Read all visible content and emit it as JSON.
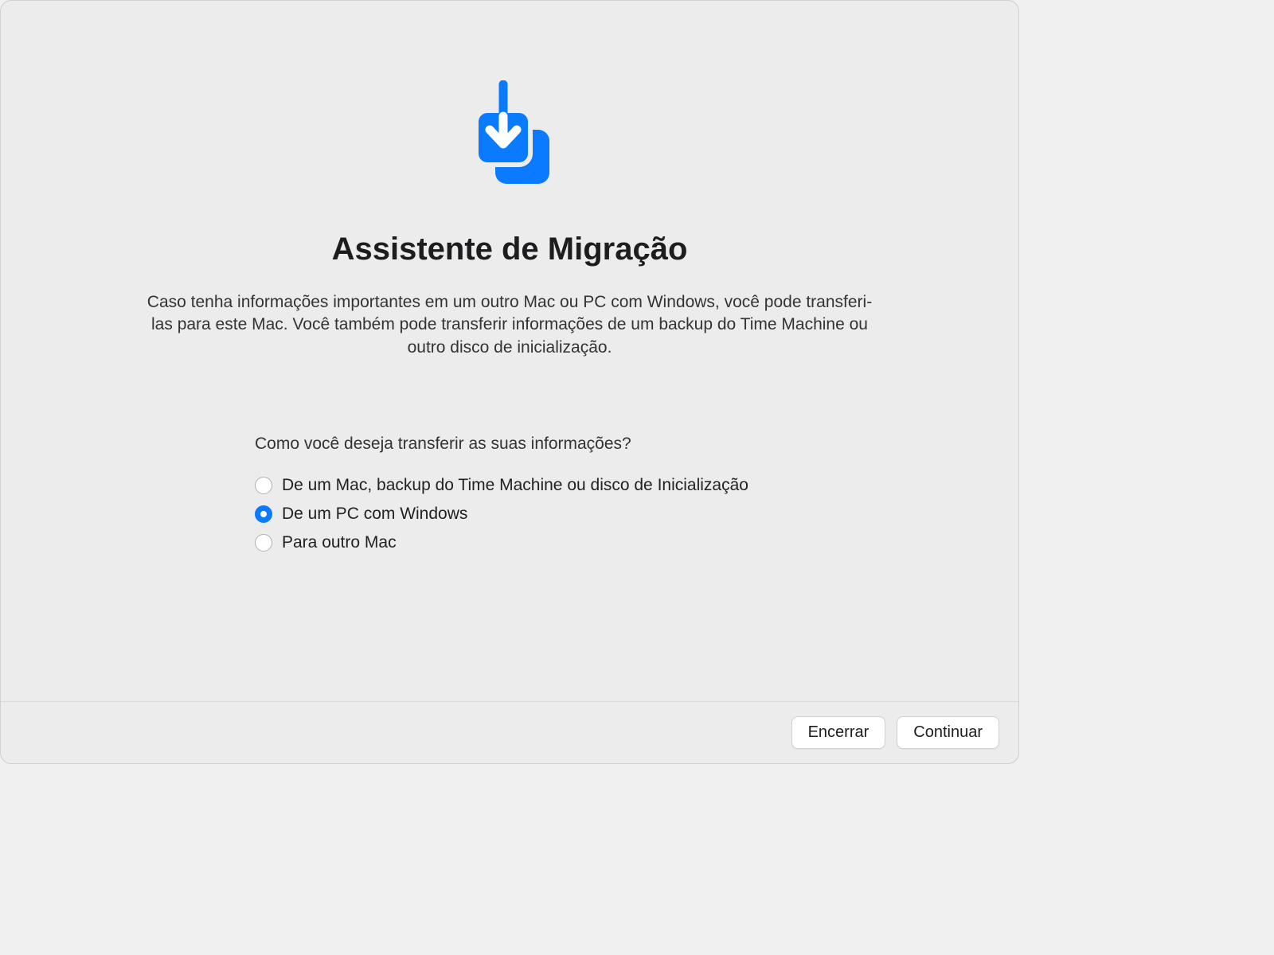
{
  "title": "Assistente de Migração",
  "description": "Caso tenha informações importantes em um outro Mac ou PC com Windows, você pode transferi-las para este Mac. Você também pode transferir informações de um backup do Time Machine ou outro disco de inicialização.",
  "question": "Como você deseja transferir as suas informações?",
  "options": {
    "fromMac": "De um Mac, backup do Time Machine ou disco de Inicialização",
    "fromPC": "De um PC com Windows",
    "toOtherMac": "Para outro Mac"
  },
  "selectedOption": "fromPC",
  "buttons": {
    "quit": "Encerrar",
    "continue": "Continuar"
  }
}
